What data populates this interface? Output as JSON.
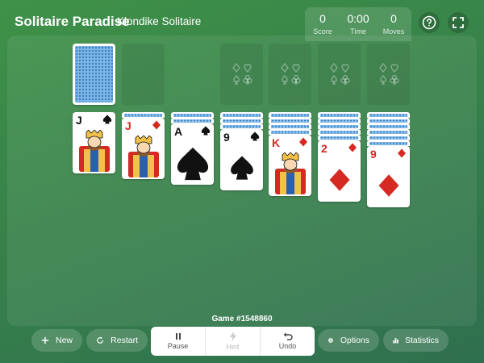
{
  "header": {
    "title": "Solitaire Paradise",
    "subtitle": "Klondike Solitaire",
    "stats": [
      {
        "value": "0",
        "label": "Score"
      },
      {
        "value": "0:00",
        "label": "Time"
      },
      {
        "value": "0",
        "label": "Moves"
      }
    ],
    "help_icon": "question-circle-icon",
    "fullscreen_icon": "fullscreen-icon"
  },
  "stock": {
    "cards_face_down": true
  },
  "waste": {
    "empty": true
  },
  "foundations": [
    {
      "icon": "suits-outline-icon"
    },
    {
      "icon": "suits-outline-icon"
    },
    {
      "icon": "suits-outline-icon"
    },
    {
      "icon": "suits-outline-icon"
    }
  ],
  "tableau": [
    {
      "face_down": 0,
      "top": {
        "rank": "J",
        "suit": "spades",
        "color": "black",
        "face": "king-figure"
      }
    },
    {
      "face_down": 1,
      "top": {
        "rank": "J",
        "suit": "diamonds",
        "color": "red",
        "face": "king-figure"
      }
    },
    {
      "face_down": 2,
      "top": {
        "rank": "A",
        "suit": "spades",
        "color": "black",
        "face": "big-pip"
      }
    },
    {
      "face_down": 3,
      "top": {
        "rank": "9",
        "suit": "spades",
        "color": "black",
        "face": "big-pip"
      }
    },
    {
      "face_down": 4,
      "top": {
        "rank": "K",
        "suit": "diamonds",
        "color": "red",
        "face": "king-figure"
      }
    },
    {
      "face_down": 5,
      "top": {
        "rank": "2",
        "suit": "diamonds",
        "color": "red",
        "face": "big-pip"
      }
    },
    {
      "face_down": 6,
      "top": {
        "rank": "9",
        "suit": "diamonds",
        "color": "red",
        "face": "big-pip"
      }
    }
  ],
  "footer": {
    "game_number": "Game #1548860",
    "new_label": "New",
    "restart_label": "Restart",
    "pause_label": "Pause",
    "hint_label": "Hint",
    "undo_label": "Undo",
    "options_label": "Options",
    "statistics_label": "Statistics"
  },
  "colors": {
    "felt": "#3a8a4a",
    "red_suit": "#d42a21",
    "black_suit": "#111111",
    "card_back": "#7fb7e6"
  }
}
